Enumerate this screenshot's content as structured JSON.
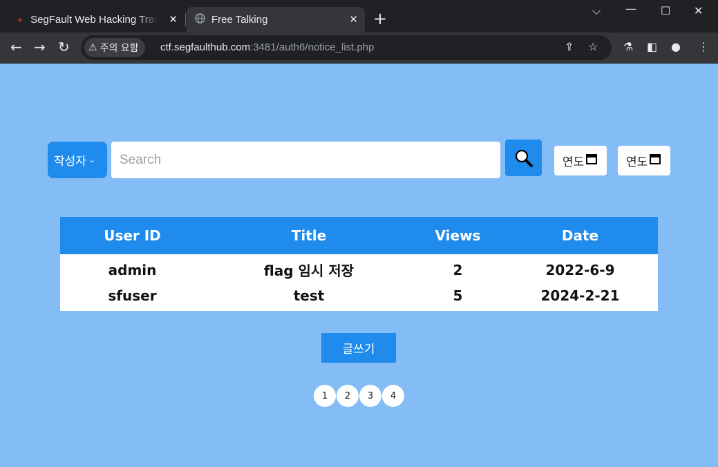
{
  "browser": {
    "tabs": [
      {
        "title": "SegFault Web Hacking Training",
        "favicon": "segfault-favicon-icon"
      },
      {
        "title": "Free Talking",
        "favicon": "globe-icon"
      }
    ],
    "security_chip": "주의 요함",
    "url_host": "ctf.segfaulthub.com",
    "url_path": ":3481/auth6/notice_list.php"
  },
  "search": {
    "filter_selected": "작성자",
    "placeholder": "Search",
    "date_from_label": "연도",
    "date_to_label": "연도"
  },
  "table": {
    "headers": [
      "User ID",
      "Title",
      "Views",
      "Date"
    ],
    "rows": [
      [
        "admin",
        "flag 임시 저장",
        "2",
        "2022-6-9"
      ],
      [
        "sfuser",
        "test",
        "5",
        "2024-2-21"
      ]
    ]
  },
  "write_button": "글쓰기",
  "pages": [
    "1",
    "2",
    "3",
    "4"
  ],
  "colors": {
    "page_bg": "#84bdf5",
    "accent": "#1f8bec"
  }
}
